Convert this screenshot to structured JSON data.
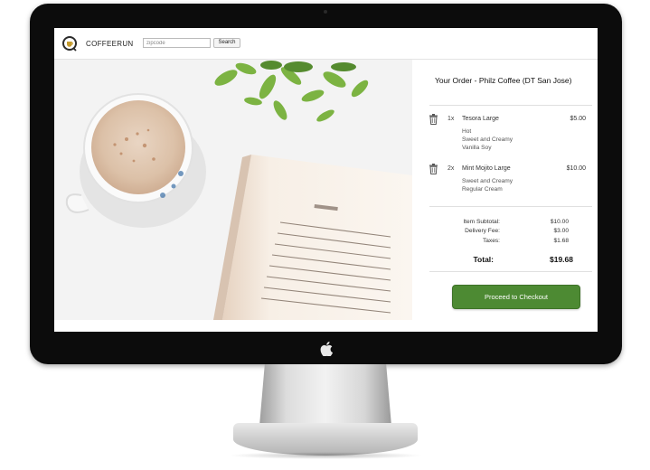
{
  "app": {
    "brand": "COFFEERUN",
    "zip_placeholder": "zipcode",
    "search_label": "Search"
  },
  "order": {
    "title": "Your Order - Philz Coffee (DT San Jose)",
    "items": [
      {
        "qty": "1x",
        "name": "Tesora Large",
        "price": "$5.00",
        "options": [
          "Hot",
          "Sweet and Creamy",
          "Vanilla Soy"
        ]
      },
      {
        "qty": "2x",
        "name": "Mint Mojito Large",
        "price": "$10.00",
        "options": [
          "Sweet and Creamy",
          "Regular Cream"
        ]
      }
    ],
    "summary": [
      {
        "label": "Item Subtotal:",
        "value": "$10.00"
      },
      {
        "label": "Delivery Fee:",
        "value": "$3.00"
      },
      {
        "label": "Taxes:",
        "value": "$1.68"
      }
    ],
    "total_label": "Total:",
    "total_value": "$19.68",
    "checkout_label": "Proceed to Checkout"
  },
  "colors": {
    "checkout_green": "#4d8a33",
    "brand_gold": "#c49a2c",
    "bezel": "#0c0c0c"
  },
  "icons": [
    "apple-logo",
    "coffee-cup-logo",
    "trash-icon"
  ]
}
